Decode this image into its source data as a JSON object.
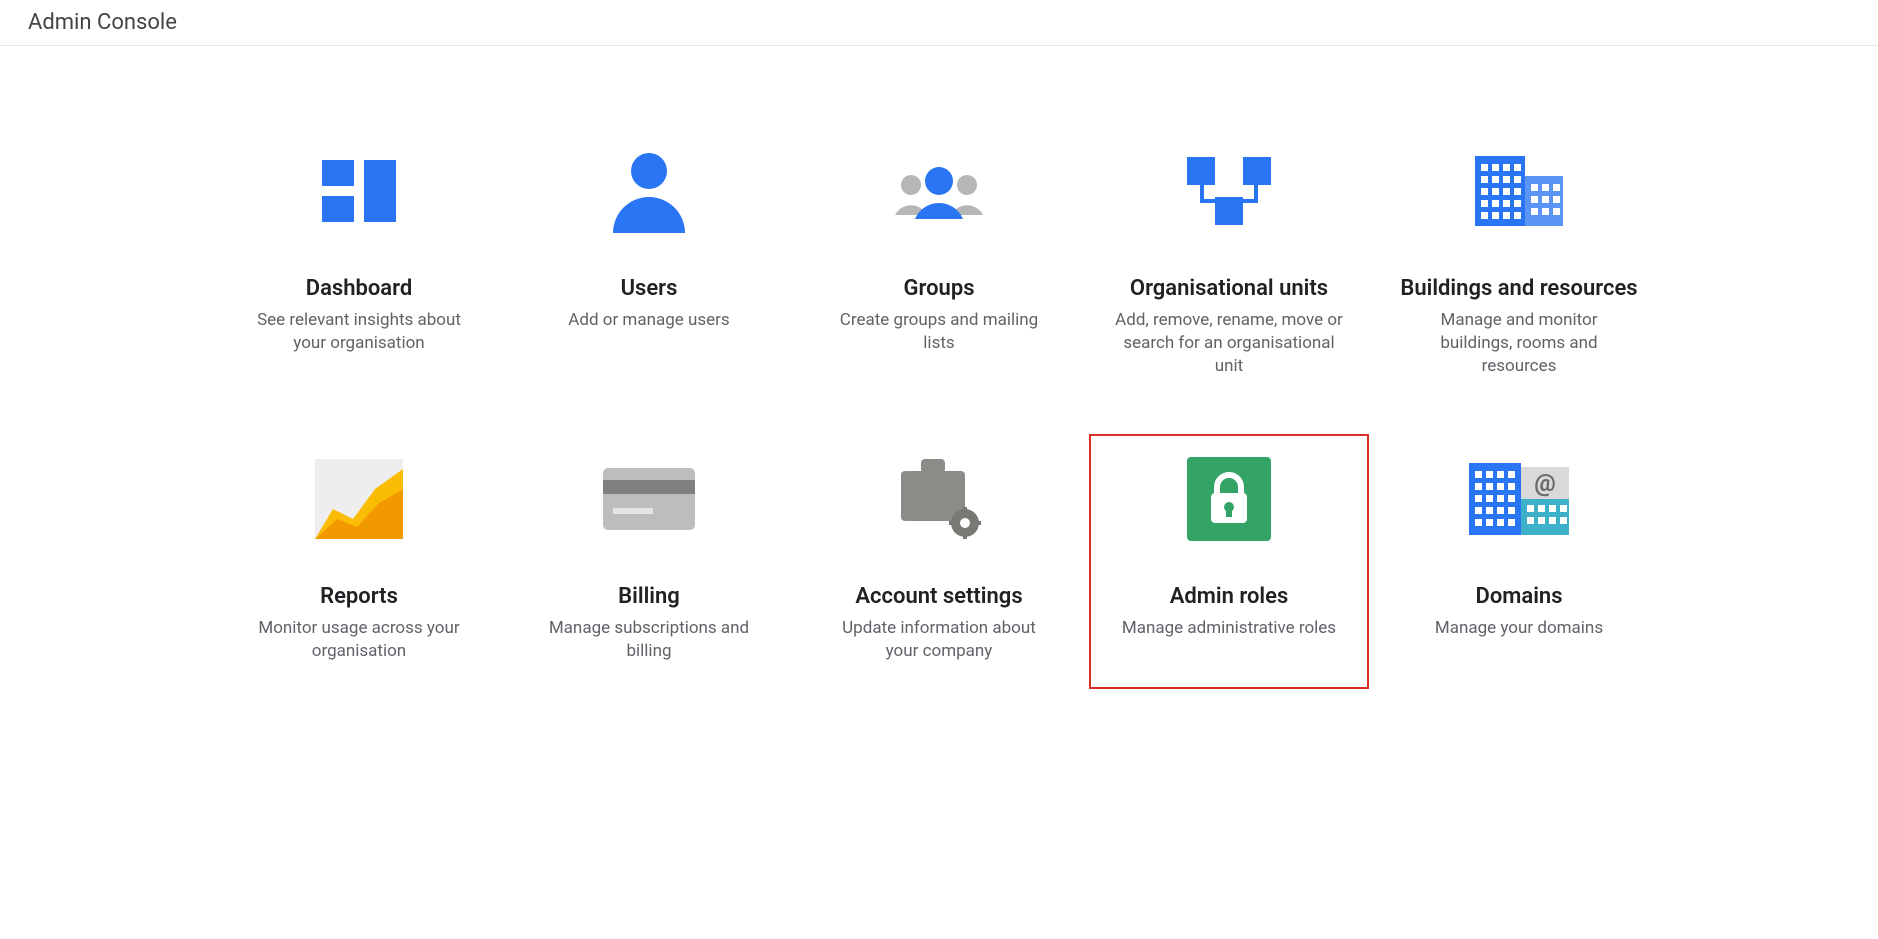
{
  "header": {
    "title": "Admin Console"
  },
  "tiles": [
    {
      "title": "Dashboard",
      "desc": "See relevant insights about your organisation"
    },
    {
      "title": "Users",
      "desc": "Add or manage users"
    },
    {
      "title": "Groups",
      "desc": "Create groups and mailing lists"
    },
    {
      "title": "Organisational units",
      "desc": "Add, remove, rename, move or search for an organisational unit"
    },
    {
      "title": "Buildings and resources",
      "desc": "Manage and monitor buildings, rooms and resources"
    },
    {
      "title": "Reports",
      "desc": "Monitor usage across your organisation"
    },
    {
      "title": "Billing",
      "desc": "Manage subscriptions and billing"
    },
    {
      "title": "Account settings",
      "desc": "Update information about your company"
    },
    {
      "title": "Admin roles",
      "desc": "Manage administrative roles"
    },
    {
      "title": "Domains",
      "desc": "Manage your domains"
    }
  ]
}
